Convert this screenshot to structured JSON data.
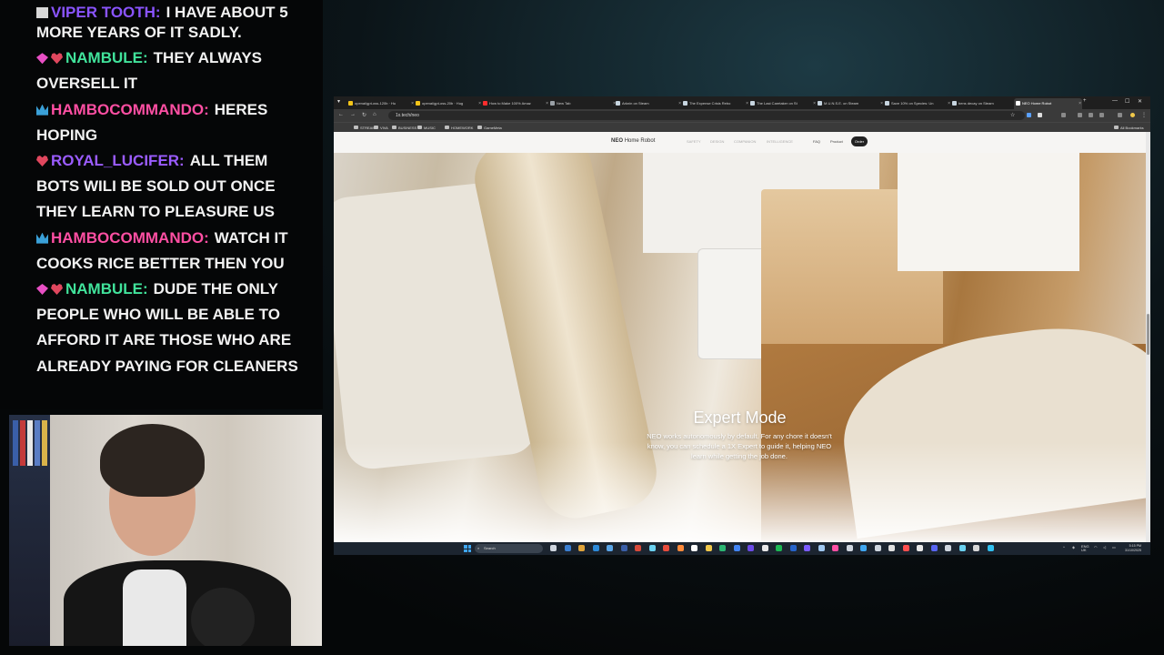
{
  "chat": {
    "messages": [
      {
        "badges": [
          "square"
        ],
        "user": "VIPER TOOTH",
        "text": "I HAVE ABOUT 5",
        "cut": true,
        "color": "#8a54ff"
      },
      {
        "badges": [],
        "user": "",
        "text": "MORE YEARS OF IT SADLY.",
        "continuation": true
      },
      {
        "badges": [
          "gem",
          "heart"
        ],
        "user": "NAMBULE",
        "text": "THEY ALWAYS OVERSELL IT",
        "color": "#41e39b"
      },
      {
        "badges": [
          "crown"
        ],
        "user": "HAMBOCOMMANDO",
        "text": "HERES HOPING",
        "color": "#ff4fa3"
      },
      {
        "badges": [
          "heart"
        ],
        "user": "ROYAL_LUCIFER",
        "text": "ALL THEM BOTS WILI BE SOLD OUT ONCE THEY LEARN TO PLEASURE US",
        "color": "#9b5cff"
      },
      {
        "badges": [
          "crown"
        ],
        "user": "HAMBOCOMMANDO",
        "text": "WATCH IT COOKS RICE BETTER THEN YOU",
        "color": "#ff4fa3"
      },
      {
        "badges": [
          "gem",
          "heart"
        ],
        "user": "NAMBULE",
        "text": "DUDE THE ONLY PEOPLE WHO WILL BE ABLE TO AFFORD IT ARE THOSE WHO ARE ALREADY PAYING FOR CLEANERS",
        "color": "#41e39b"
      }
    ]
  },
  "browser": {
    "tabs": [
      {
        "label": "openai/gpt-oss-120b · Hu",
        "favicon": "#f5c518"
      },
      {
        "label": "openai/gpt-oss-20b · Hug",
        "favicon": "#f5c518"
      },
      {
        "label": "How to Make 100% Amaz",
        "favicon": "#ff2d2d"
      },
      {
        "label": "New Tab",
        "favicon": "#9aa0a6"
      },
      {
        "label": "Arknin on Steam",
        "favicon": "#c7d5e0"
      },
      {
        "label": "The Expense Crisis Rebo",
        "favicon": "#c7d5e0"
      },
      {
        "label": "The Last Caretaker on St",
        "favicon": "#c7d5e0"
      },
      {
        "label": "M.U.N.S.E. on Steam",
        "favicon": "#c7d5e0"
      },
      {
        "label": "Save 10% on Species: Un",
        "favicon": "#c7d5e0"
      },
      {
        "label": "bens decay on Steam",
        "favicon": "#c7d5e0"
      },
      {
        "label": "NEO Home Robot",
        "favicon": "#ffffff",
        "active": true
      }
    ],
    "new_tab": "+",
    "window_controls": [
      "—",
      "☐",
      "✕"
    ],
    "url": "1x.tech/neo",
    "bookmarks": [
      "STREAM",
      "VIVA",
      "BUSINESS",
      "MUSIC",
      "HOMEWORK",
      "GameMeta"
    ],
    "all_bookmarks": "All Bookmarks"
  },
  "site": {
    "brand_bold": "NEO",
    "brand_rest": "Home Robot",
    "nav_left": [
      "SAFETY",
      "DESIGN",
      "COMPANION",
      "INTELLIGENCE"
    ],
    "nav_right": [
      "FAQ",
      "Product"
    ],
    "order_label": "Order",
    "hero_title": "Expert Mode",
    "hero_body": "NEO works autonomously by default. For any chore it doesn't know, you can schedule a 1X Expert to guide it, helping NEO learn while getting the job done."
  },
  "taskbar": {
    "search_placeholder": "Search",
    "tray_lang": "ENG",
    "tray_region": "UK",
    "time": "5:15 PM",
    "date": "31/10/2025"
  }
}
